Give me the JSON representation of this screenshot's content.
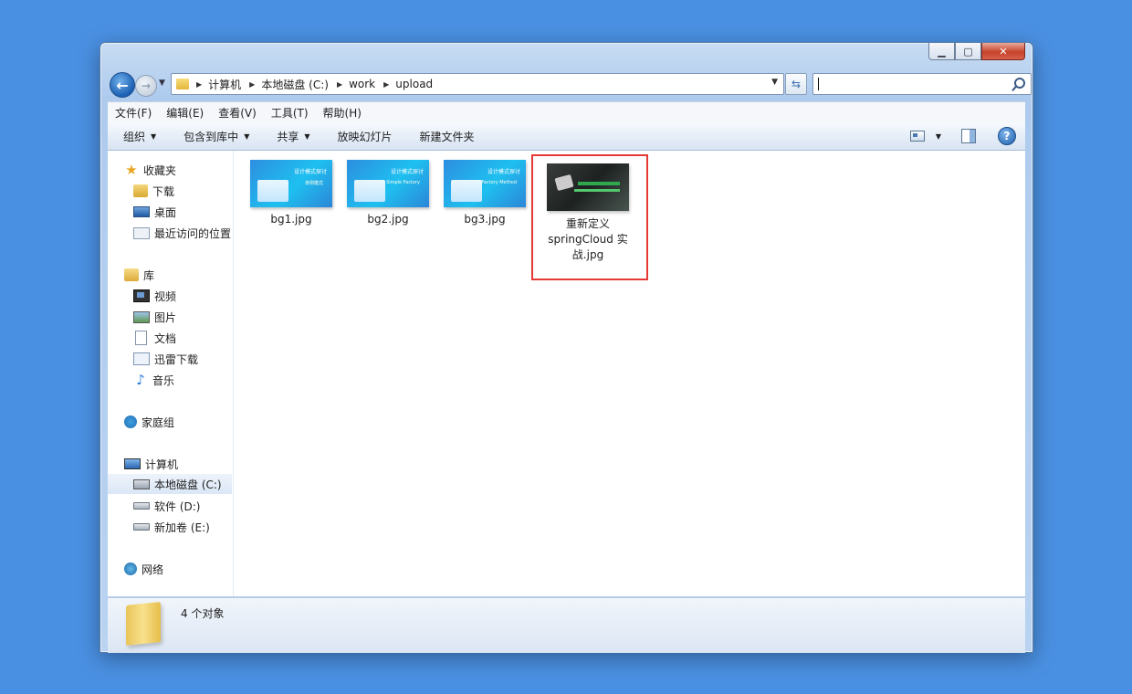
{
  "breadcrumb": [
    "计算机",
    "本地磁盘 (C:)",
    "work",
    "upload"
  ],
  "search": {
    "placeholder": ""
  },
  "menu": [
    "文件(F)",
    "编辑(E)",
    "查看(V)",
    "工具(T)",
    "帮助(H)"
  ],
  "toolbar": {
    "organize": "组织",
    "include_library": "包含到库中",
    "share": "共享",
    "slideshow": "放映幻灯片",
    "new_folder": "新建文件夹"
  },
  "sidebar": {
    "favorites": "收藏夹",
    "downloads": "下载",
    "desktop": "桌面",
    "recent": "最近访问的位置",
    "libraries": "库",
    "videos": "视频",
    "pictures": "图片",
    "documents": "文档",
    "thunder": "迅雷下载",
    "music": "音乐",
    "homegroup": "家庭组",
    "computer": "计算机",
    "c_drive": "本地磁盘 (C:)",
    "d_drive": "软件 (D:)",
    "e_drive": "新加卷 (E:)",
    "network": "网络"
  },
  "files": [
    {
      "name": "bg1.jpg",
      "thumb_title": "设计模式探讨",
      "thumb_sub": "单例模式"
    },
    {
      "name": "bg2.jpg",
      "thumb_title": "设计模式探讨",
      "thumb_sub": "Simple Factory"
    },
    {
      "name": "bg3.jpg",
      "thumb_title": "设计模式探讨",
      "thumb_sub": "Factory Method"
    },
    {
      "name": "重新定义 springCloud 实战.jpg"
    }
  ],
  "status": {
    "count": "4 个对象"
  },
  "icons": {
    "back": "back-arrow-icon",
    "forward": "forward-arrow-icon",
    "refresh": "refresh-icon",
    "search": "search-icon",
    "help": "help-icon"
  }
}
